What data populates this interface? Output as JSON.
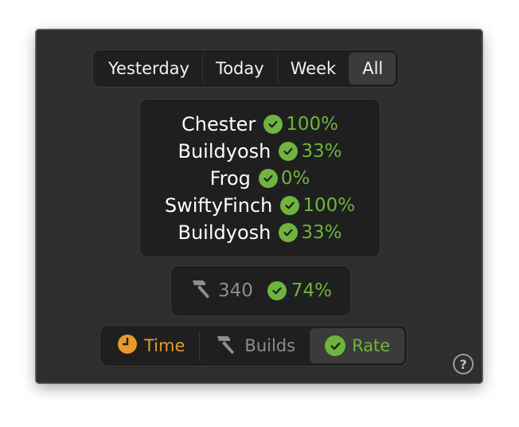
{
  "period_tabs": [
    {
      "label": "Yesterday",
      "active": false
    },
    {
      "label": "Today",
      "active": false
    },
    {
      "label": "Week",
      "active": false
    },
    {
      "label": "All",
      "active": true
    }
  ],
  "projects": [
    {
      "name": "Chester",
      "rate": "100%",
      "status_icon": "check-circle-icon"
    },
    {
      "name": "Buildyosh",
      "rate": "33%",
      "status_icon": "check-circle-icon"
    },
    {
      "name": "Frog",
      "rate": "0%",
      "status_icon": "check-circle-icon"
    },
    {
      "name": "SwiftyFinch",
      "rate": "100%",
      "status_icon": "check-circle-icon"
    },
    {
      "name": "Buildyosh",
      "rate": "33%",
      "status_icon": "check-circle-icon"
    }
  ],
  "summary": {
    "builds": "340",
    "rate": "74%"
  },
  "metric_tabs": [
    {
      "label": "Time",
      "icon": "clock-icon",
      "active": false
    },
    {
      "label": "Builds",
      "icon": "hammer-icon",
      "active": false
    },
    {
      "label": "Rate",
      "icon": "check-circle-icon",
      "active": true
    }
  ],
  "help": {
    "symbol": "?"
  },
  "colors": {
    "success": "#6fb43e",
    "time": "#e69a2e",
    "muted": "#8d8d8d",
    "panel": "#2e2e2e"
  }
}
